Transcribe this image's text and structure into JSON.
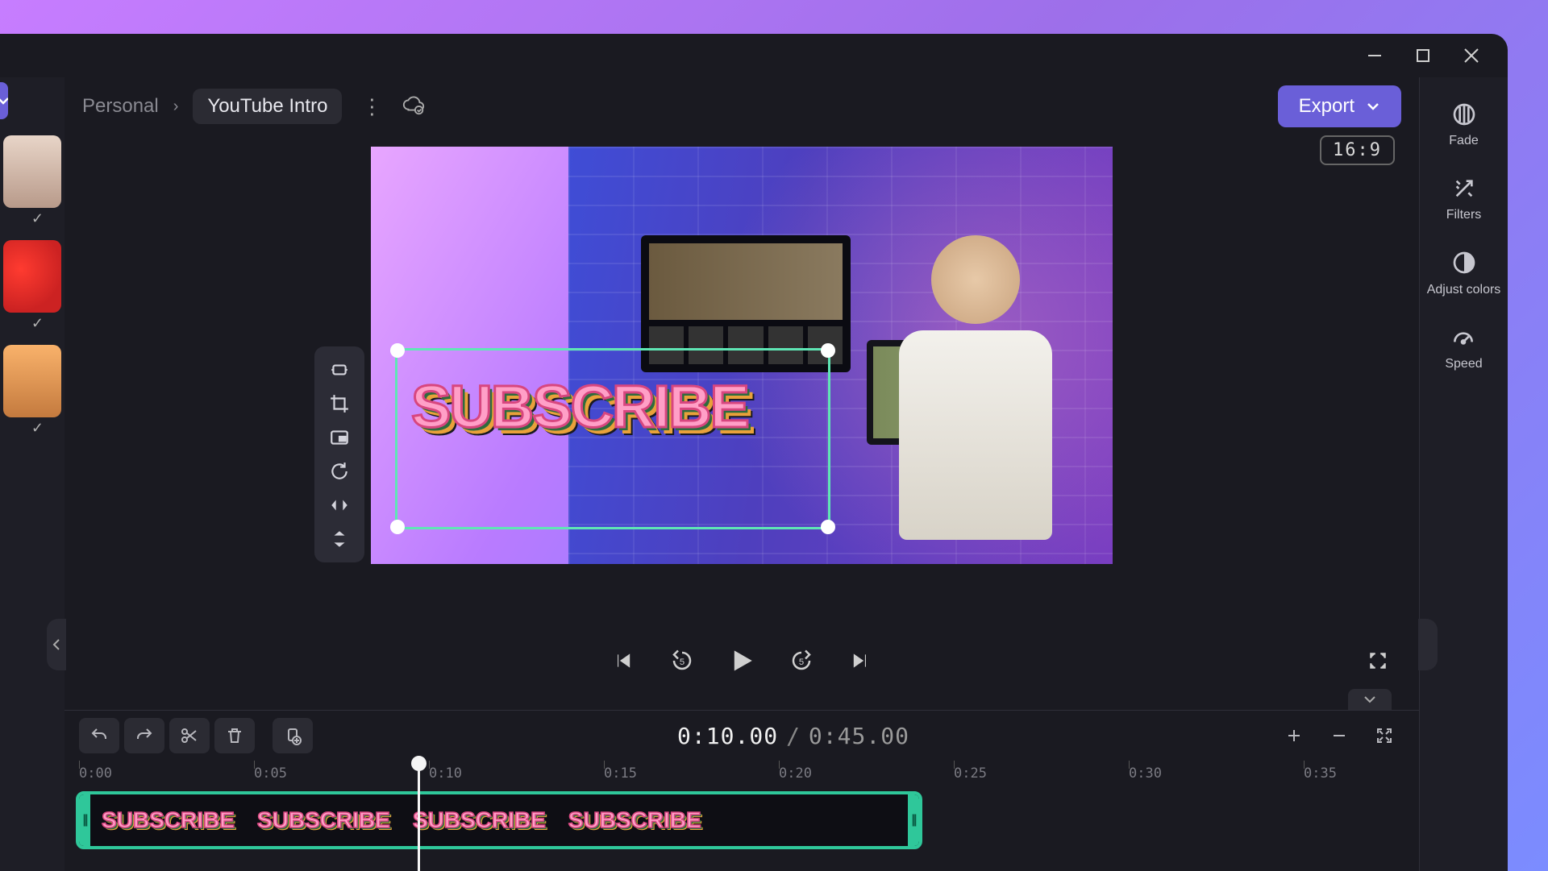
{
  "window": {
    "minimize": "—",
    "maximize": "▢",
    "close": "✕"
  },
  "header": {
    "workspace": "Personal",
    "project_name": "YouTube Intro",
    "export_label": "Export"
  },
  "stage": {
    "aspect_ratio": "16:9",
    "overlay_text": "SUBSCRIBE"
  },
  "float_tools": [
    "fit-icon",
    "crop-icon",
    "pip-icon",
    "rotate-icon",
    "flip-h-icon",
    "flip-v-icon"
  ],
  "right_panel": {
    "items": [
      {
        "label": "Fade",
        "icon": "fade-icon"
      },
      {
        "label": "Filters",
        "icon": "filters-icon"
      },
      {
        "label": "Adjust colors",
        "icon": "adjust-colors-icon"
      },
      {
        "label": "Speed",
        "icon": "speed-icon"
      }
    ]
  },
  "playback": {
    "current_time": "0:10.00",
    "duration": "0:45.00"
  },
  "ruler": [
    "0:00",
    "0:05",
    "0:10",
    "0:15",
    "0:20",
    "0:25",
    "0:30",
    "0:35"
  ],
  "clip": {
    "thumb_text": "SUBSCRIBE"
  }
}
